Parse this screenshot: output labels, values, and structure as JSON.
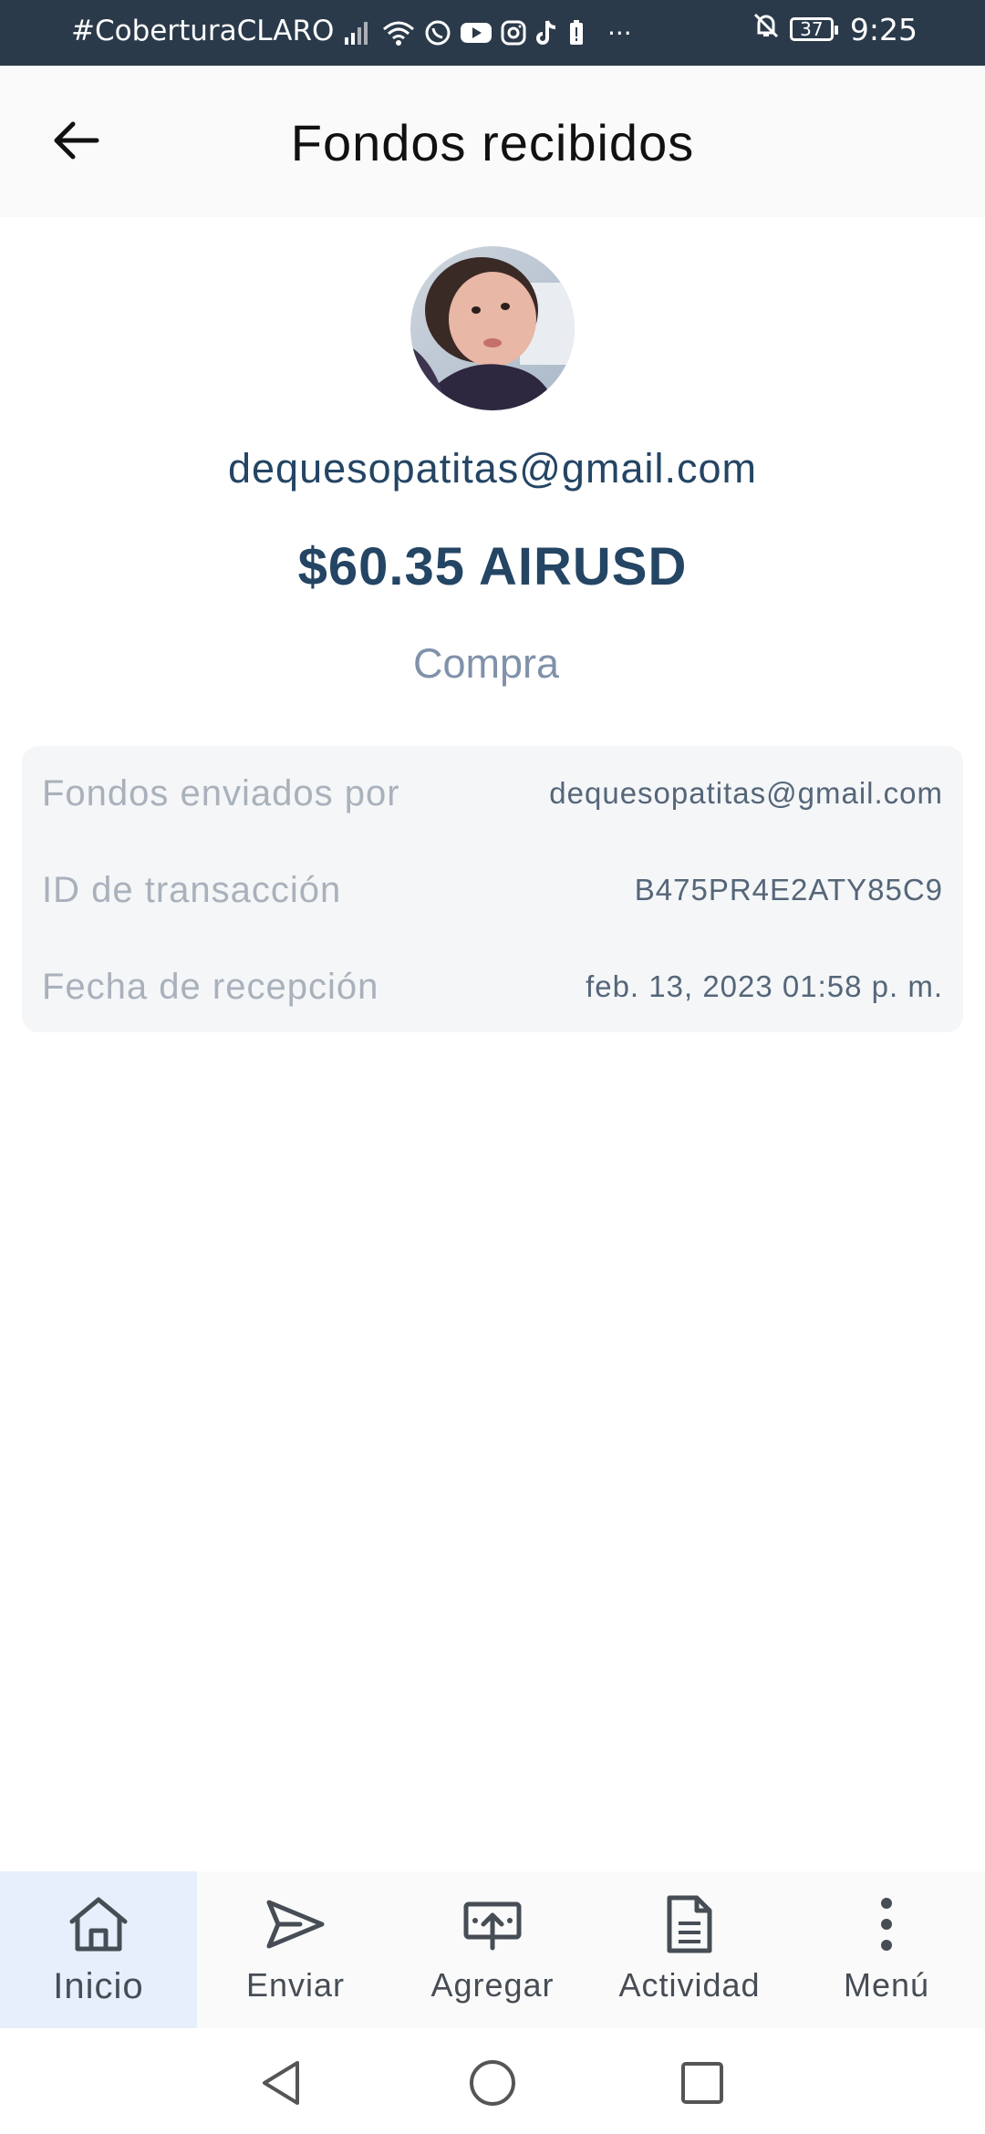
{
  "status_bar": {
    "carrier": "#CoberturaCLARO",
    "battery": "37",
    "time": "9:25",
    "icons": [
      "signal-icon",
      "wifi-icon",
      "whatsapp-icon",
      "youtube-icon",
      "instagram-icon",
      "tiktok-icon",
      "battery-alert-icon",
      "more-dots-icon",
      "bell-off-icon",
      "battery-icon"
    ]
  },
  "header": {
    "title": "Fondos recibidos"
  },
  "profile": {
    "email": "dequesopatitas@gmail.com",
    "amount": "$60.35 AIRUSD",
    "type": "Compra"
  },
  "details": [
    {
      "label": "Fondos enviados por",
      "value": "dequesopatitas@gmail.com"
    },
    {
      "label": "ID de transacción",
      "value": "B475PR4E2ATY85C9"
    },
    {
      "label": "Fecha de recepción",
      "value": "feb. 13, 2023 01:58 p. m."
    }
  ],
  "bottom_nav": [
    {
      "label": "Inicio",
      "icon": "home-icon",
      "active": true
    },
    {
      "label": "Enviar",
      "icon": "send-icon",
      "active": false
    },
    {
      "label": "Agregar",
      "icon": "add-funds-icon",
      "active": false
    },
    {
      "label": "Actividad",
      "icon": "document-icon",
      "active": false
    },
    {
      "label": "Menú",
      "icon": "more-vertical-icon",
      "active": false
    }
  ],
  "colors": {
    "status_bar_bg": "#2b3a4a",
    "primary_text": "#244564",
    "active_nav_bg": "#e6effb"
  }
}
